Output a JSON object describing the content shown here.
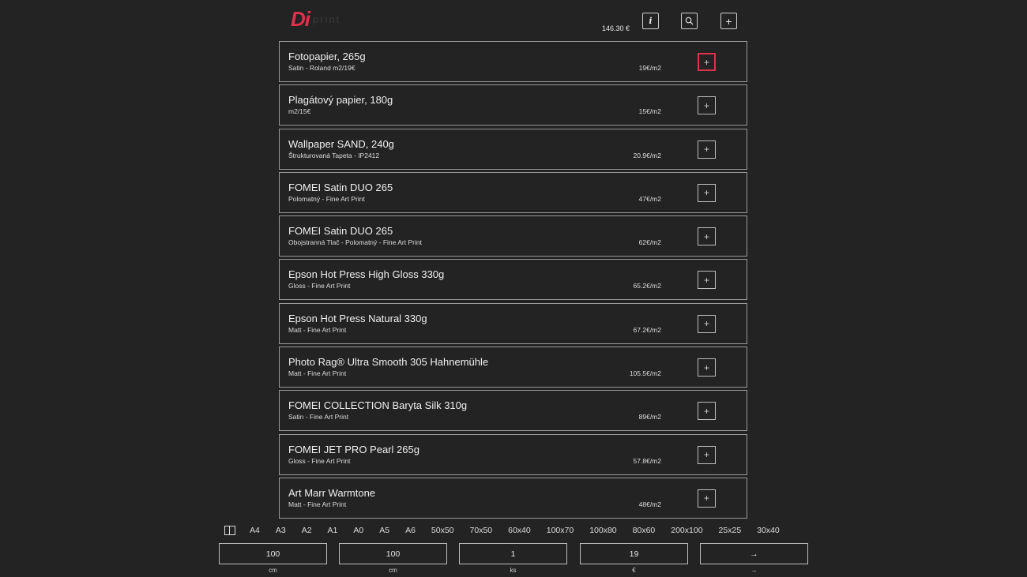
{
  "header": {
    "logo_mark": "Di",
    "logo_text": "print",
    "total": "146.30 €",
    "info_label": "i",
    "add_label": "+"
  },
  "products": [
    {
      "title": "Fotopapier, 265g",
      "subtitle": "Satin - Roland m2/19€",
      "price": "19€/m2",
      "selected": true
    },
    {
      "title": "Plagátový papier, 180g",
      "subtitle": "m2/15€",
      "price": "15€/m2"
    },
    {
      "title": "Wallpaper SAND, 240g",
      "subtitle": "Štrukturovaná Tapeta - IP2412",
      "price": "20.9€/m2"
    },
    {
      "title": "FOMEI Satin DUO 265",
      "subtitle": "Polomatný - Fine Art Print",
      "price": "47€/m2"
    },
    {
      "title": "FOMEI Satin DUO 265",
      "subtitle": "Obojstranná Tlač - Polomatný - Fine Art Print",
      "price": "62€/m2"
    },
    {
      "title": "Epson Hot Press High Gloss 330g",
      "subtitle": "Gloss - Fine Art Print",
      "price": "65.2€/m2"
    },
    {
      "title": "Epson Hot Press Natural 330g",
      "subtitle": "Matt - Fine Art Print",
      "price": "67.2€/m2"
    },
    {
      "title": "Photo Rag® Ultra Smooth 305 Hahnemühle",
      "subtitle": "Matt - Fine Art Print",
      "price": "105.5€/m2"
    },
    {
      "title": "FOMEI COLLECTION Baryta Silk 310g",
      "subtitle": "Satin - Fine Art Print",
      "price": "89€/m2"
    },
    {
      "title": "FOMEI JET PRO Pearl 265g",
      "subtitle": "Gloss - Fine Art Print",
      "price": "57.8€/m2"
    },
    {
      "title": "Art Marr Warmtone",
      "subtitle": "Matt - Fine Art Print",
      "price": "48€/m2"
    }
  ],
  "item_add_label": "+",
  "sizes": [
    "A4",
    "A3",
    "A2",
    "A1",
    "A0",
    "A5",
    "A6",
    "50x50",
    "70x50",
    "60x40",
    "100x70",
    "100x80",
    "80x60",
    "200x100",
    "25x25",
    "30x40"
  ],
  "inputs": {
    "width": {
      "value": "100",
      "unit": "cm"
    },
    "height": {
      "value": "100",
      "unit": "cm"
    },
    "quantity": {
      "value": "1",
      "unit": "ks"
    },
    "price": {
      "value": "19",
      "unit": "€"
    },
    "submit": {
      "label": "→",
      "unit": "→"
    }
  },
  "colors": {
    "background": "#232323",
    "accent": "#e0314b",
    "border": "#9a9a9a"
  }
}
